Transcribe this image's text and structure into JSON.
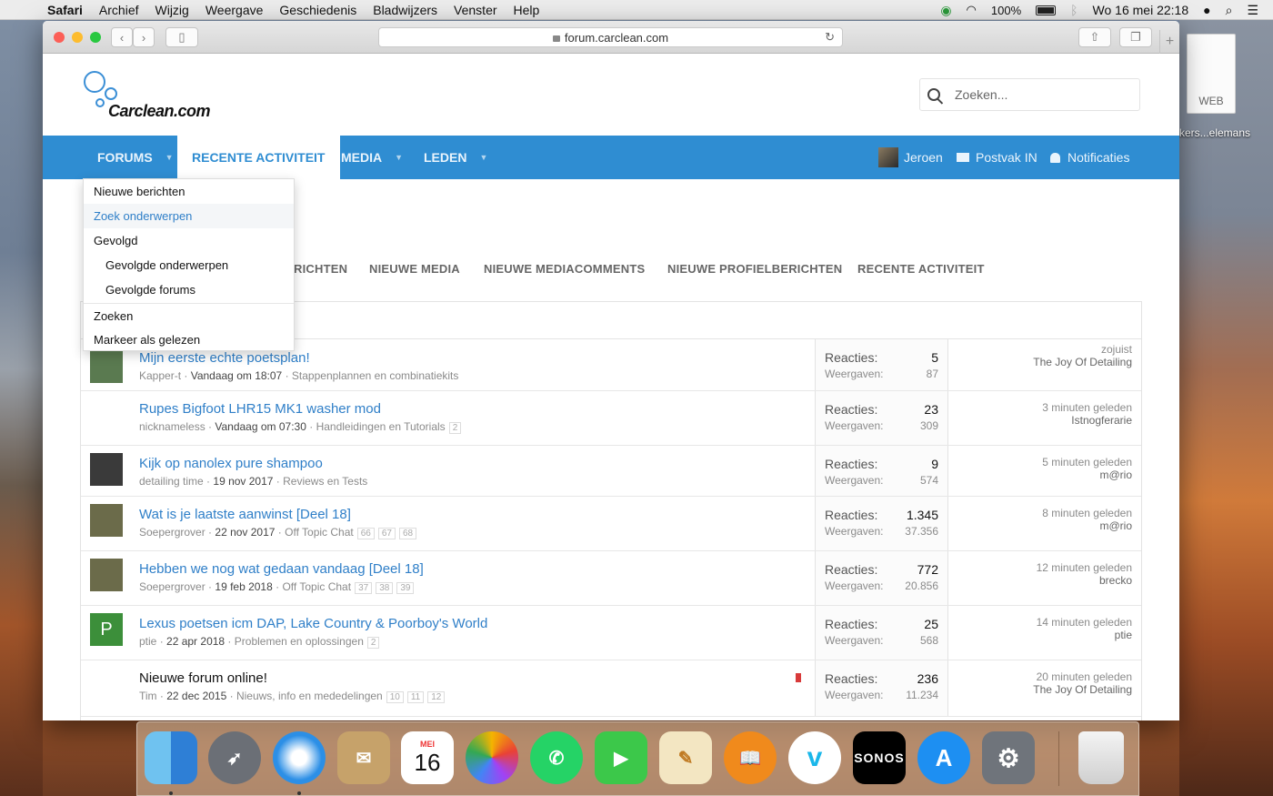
{
  "menubar": {
    "app": "Safari",
    "items": [
      "Archief",
      "Wijzig",
      "Weergave",
      "Geschiedenis",
      "Bladwijzers",
      "Venster",
      "Help"
    ],
    "battery": "100%",
    "datetime": "Wo 16 mei  22:18"
  },
  "desktop": {
    "file_label": "WEB",
    "file_name": "kers...elemans"
  },
  "browser": {
    "url": "forum.carclean.com"
  },
  "site": {
    "logo": "Carclean.com",
    "search_placeholder": "Zoeken..."
  },
  "nav": {
    "tabs": [
      {
        "label": "FORUMS"
      },
      {
        "label": "RECENTE ACTIVITEIT"
      },
      {
        "label": "MEDIA"
      },
      {
        "label": "LEDEN"
      }
    ],
    "user": "Jeroen",
    "inbox": "Postvak IN",
    "notifications": "Notificaties"
  },
  "dropdown": {
    "items": [
      {
        "label": "Nieuwe berichten"
      },
      {
        "label": "Zoek onderwerpen"
      },
      {
        "label": "Gevolgd"
      },
      {
        "label": "Gevolgde onderwerpen"
      },
      {
        "label": "Gevolgde forums"
      },
      {
        "label": "Zoeken"
      },
      {
        "label": "Markeer als gelezen"
      }
    ]
  },
  "subtabs": [
    "RICHTEN",
    "NIEUWE MEDIA",
    "NIEUWE MEDIACOMMENTS",
    "NIEUWE PROFIELBERICHTEN",
    "RECENTE ACTIVITEIT"
  ],
  "stats_labels": {
    "replies": "Reacties:",
    "views": "Weergaven:"
  },
  "threads": [
    {
      "title": "Mijn eerste echte poetsplan!",
      "author": "Kapper-t",
      "date": "Vandaag om 18:07",
      "forum": "Stappenplannen en combinatiekits",
      "pages": [],
      "replies": "5",
      "views": "87",
      "last_time": "zojuist",
      "last_user": "The Joy Of Detailing",
      "avatar_color": "#5a7a50",
      "avatar_letter": ""
    },
    {
      "title": "Rupes Bigfoot LHR15 MK1 washer mod",
      "author": "nicknameless",
      "date": "Vandaag om 07:30",
      "forum": "Handleidingen en Tutorials",
      "pages": [
        "2"
      ],
      "replies": "23",
      "views": "309",
      "last_time": "3 minuten geleden",
      "last_user": "Istnogferarie",
      "avatar_color": "#ffffff",
      "avatar_letter": ""
    },
    {
      "title": "Kijk op nanolex pure shampoo",
      "author": "detailing time",
      "date": "19 nov 2017",
      "forum": "Reviews en Tests",
      "pages": [],
      "replies": "9",
      "views": "574",
      "last_time": "5 minuten geleden",
      "last_user": "m@rio",
      "avatar_color": "#3a3a3a",
      "avatar_letter": ""
    },
    {
      "title": "Wat is je laatste aanwinst [Deel 18]",
      "author": "Soepergrover",
      "date": "22 nov 2017",
      "forum": "Off Topic Chat",
      "pages": [
        "66",
        "67",
        "68"
      ],
      "replies": "1.345",
      "views": "37.356",
      "last_time": "8 minuten geleden",
      "last_user": "m@rio",
      "avatar_color": "#6b6b4a",
      "avatar_letter": ""
    },
    {
      "title": "Hebben we nog wat gedaan vandaag [Deel 18]",
      "author": "Soepergrover",
      "date": "19 feb 2018",
      "forum": "Off Topic Chat",
      "pages": [
        "37",
        "38",
        "39"
      ],
      "replies": "772",
      "views": "20.856",
      "last_time": "12 minuten geleden",
      "last_user": "brecko",
      "avatar_color": "#6b6b4a",
      "avatar_letter": ""
    },
    {
      "title": "Lexus poetsen icm DAP, Lake Country & Poorboy's World",
      "author": "ptie",
      "date": "22 apr 2018",
      "forum": "Problemen en oplossingen",
      "pages": [
        "2"
      ],
      "replies": "25",
      "views": "568",
      "last_time": "14 minuten geleden",
      "last_user": "ptie",
      "avatar_color": "#3c8f3a",
      "avatar_letter": "P"
    },
    {
      "title": "Nieuwe forum online!",
      "author": "Tim",
      "date": "22 dec 2015",
      "forum": "Nieuws, info en mededelingen",
      "pages": [
        "10",
        "11",
        "12"
      ],
      "replies": "236",
      "views": "11.234",
      "last_time": "20 minuten geleden",
      "last_user": "The Joy Of Detailing",
      "avatar_color": "#ffffff",
      "avatar_letter": ""
    }
  ],
  "dock": {
    "calendar_month": "MEI",
    "calendar_day": "16",
    "sonos": "SONOS"
  }
}
